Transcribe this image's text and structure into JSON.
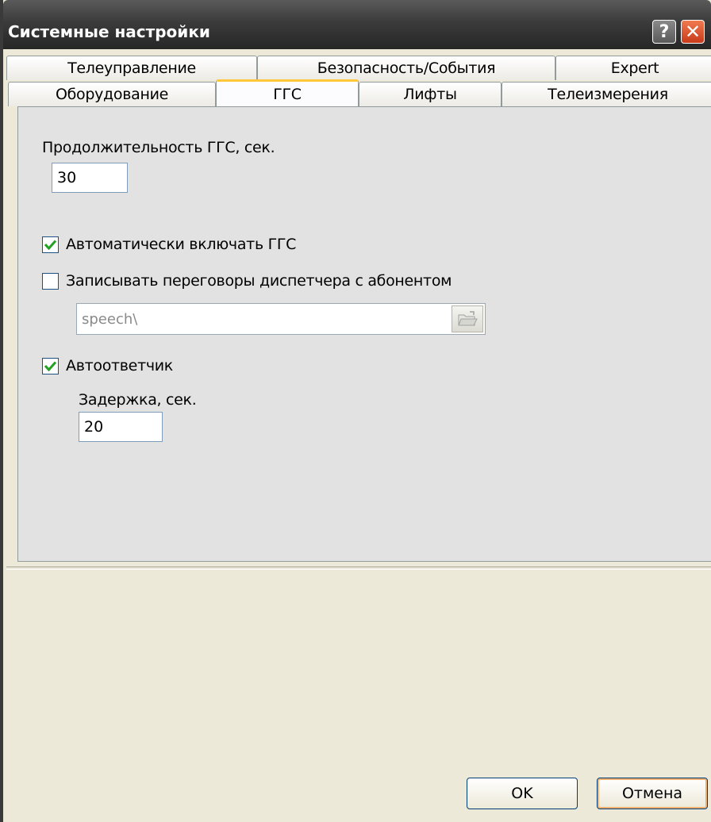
{
  "window": {
    "title": "Системные настройки"
  },
  "titlebar_buttons": {
    "help": "?",
    "close": "✕"
  },
  "tabs_row1": [
    {
      "label": "Телеуправление"
    },
    {
      "label": "Безопасность/События"
    },
    {
      "label": "Expert"
    }
  ],
  "tabs_row2": [
    {
      "label": "Оборудование"
    },
    {
      "label": "ГГС",
      "active": true
    },
    {
      "label": "Лифты"
    },
    {
      "label": "Телеизмерения"
    }
  ],
  "ggs": {
    "duration_label": "Продолжительность ГГС, сек.",
    "duration_value": "30",
    "auto_enable_label": "Автоматически включать ГГС",
    "auto_enable_checked": true,
    "record_label": "Записывать переговоры диспетчера с абонентом",
    "record_checked": false,
    "record_path": "speech\\",
    "answering_label": "Автоответчик",
    "answering_checked": true,
    "delay_label": "Задержка, сек.",
    "delay_value": "20"
  },
  "buttons": {
    "ok": "OK",
    "cancel": "Отмена"
  },
  "colors": {
    "titlebar": "#3b3b3b",
    "active_tab_accent": "#ffc83c",
    "close_button": "#d8502a",
    "panel": "#e2e2e2"
  }
}
